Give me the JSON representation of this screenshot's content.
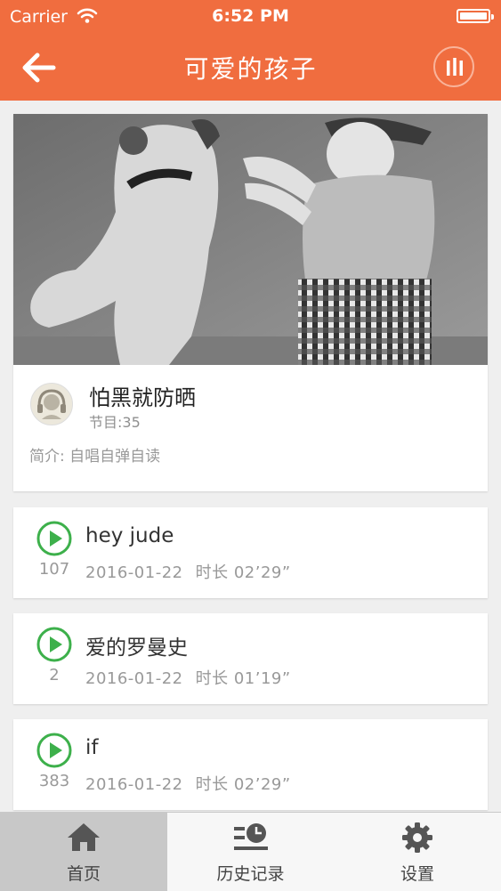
{
  "status_bar": {
    "carrier": "Carrier",
    "time": "6:52 PM"
  },
  "nav": {
    "title": "可爱的孩子",
    "back_icon": "arrow-left-icon",
    "player_icon": "equalizer-bars-icon",
    "background_color": "#f06d3f"
  },
  "album": {
    "name": "怕黑就防晒",
    "episode_count": "节目:35",
    "description": "简介:  自唱自弹自读"
  },
  "tracks": [
    {
      "title": "hey jude",
      "plays": "107",
      "date": "2016-01-22",
      "duration": "时长 02’29”"
    },
    {
      "title": "爱的罗曼史",
      "plays": "2",
      "date": "2016-01-22",
      "duration": "时长 01’19”"
    },
    {
      "title": "if",
      "plays": "383",
      "date": "2016-01-22",
      "duration": "时长 02’29”"
    }
  ],
  "tabbar": {
    "items": [
      {
        "label": "首页",
        "icon": "home-icon",
        "active": true
      },
      {
        "label": "历史记录",
        "icon": "history-icon",
        "active": false
      },
      {
        "label": "设置",
        "icon": "gear-icon",
        "active": false
      }
    ]
  },
  "colors": {
    "accent": "#f06d3f",
    "play_green": "#3db04b"
  }
}
